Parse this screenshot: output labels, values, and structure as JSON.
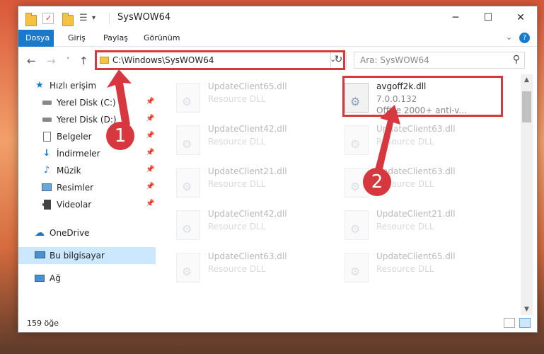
{
  "window": {
    "title": "SysWOW64",
    "controls": {
      "minimize": "─",
      "maximize": "☐",
      "close": "✕"
    }
  },
  "ribbon": {
    "tabs": [
      {
        "label": "Dosya",
        "active": true
      },
      {
        "label": "Giriş",
        "active": false
      },
      {
        "label": "Paylaş",
        "active": false
      },
      {
        "label": "Görünüm",
        "active": false
      }
    ],
    "expand_icon": "chevron-down-icon",
    "help_icon": "help-icon"
  },
  "navigation": {
    "address": "C:\\Windows\\SysWOW64",
    "search_placeholder": "Ara: SysWOW64"
  },
  "sidebar": {
    "items": [
      {
        "label": "Hızlı erişim",
        "icon": "star-icon",
        "pinned": false
      },
      {
        "label": "Yerel Disk (C:)",
        "icon": "drive-icon",
        "pinned": true
      },
      {
        "label": "Yerel Disk (D:)",
        "icon": "drive-icon",
        "pinned": true
      },
      {
        "label": "Belgeler",
        "icon": "document-icon",
        "pinned": true
      },
      {
        "label": "İndirmeler",
        "icon": "download-icon",
        "pinned": true
      },
      {
        "label": "Müzik",
        "icon": "music-icon",
        "pinned": true
      },
      {
        "label": "Resimler",
        "icon": "pictures-icon",
        "pinned": true
      },
      {
        "label": "Videolar",
        "icon": "video-icon",
        "pinned": true
      },
      {
        "label": "OneDrive",
        "icon": "cloud-icon",
        "pinned": false
      },
      {
        "label": "Bu bilgisayar",
        "icon": "computer-icon",
        "pinned": false,
        "selected": true
      },
      {
        "label": "Ağ",
        "icon": "network-icon",
        "pinned": false
      }
    ]
  },
  "files": {
    "highlighted": {
      "name": "avgoff2k.dll",
      "version": "7.0.0.132",
      "description": "Office 2000+ anti-v..."
    },
    "left_column": [
      {
        "name": "UpdateClient65.dll",
        "desc": "Resource DLL"
      },
      {
        "name": "UpdateClient42.dll",
        "desc": "Resource DLL"
      },
      {
        "name": "UpdateClient21.dll",
        "desc": "Resource DLL"
      },
      {
        "name": "UpdateClient42.dll",
        "desc": "Resource DLL"
      },
      {
        "name": "UpdateClient63.dll",
        "desc": "Resource DLL"
      }
    ],
    "right_column": [
      {
        "name": "UpdateClient63.dll",
        "desc": "Resource DLL"
      },
      {
        "name": "UpdateClient63.dll",
        "desc": "Resource DLL"
      },
      {
        "name": "UpdateClient21.dll",
        "desc": "Resource DLL"
      },
      {
        "name": "UpdateClient65.dll",
        "desc": "Resource DLL"
      }
    ]
  },
  "status": {
    "count": "159 öğe"
  },
  "annotations": {
    "step1": "1",
    "step2": "2",
    "color": "#d7373f"
  }
}
